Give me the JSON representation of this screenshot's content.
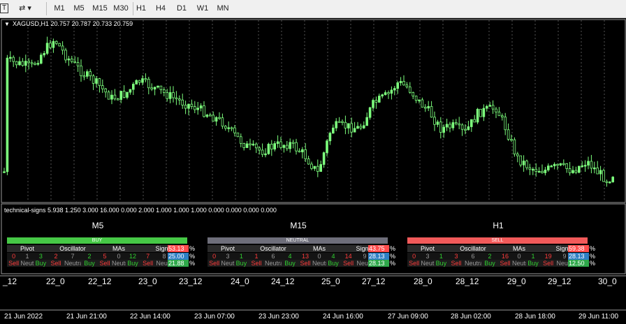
{
  "toolbar": {
    "timeframes": [
      "M1",
      "M5",
      "M15",
      "M30",
      "H1",
      "H4",
      "D1",
      "W1",
      "MN"
    ],
    "active": "H1"
  },
  "chart": {
    "header": "XAGUSD,H1  20.757 20.787 20.733 20.759",
    "subwindow_label": "technical-signs 5.938 1.250 3.000 16.000 0.000 2.000 1.000 1.000 1.000 0.000 0.000 0.000 0.000",
    "custom_time_labels": [
      "_12",
      "22_0",
      "22_12",
      "23_0",
      "23_12",
      "24_0",
      "24_12",
      "25_0",
      "27_12",
      "28_0",
      "28_12",
      "29_0",
      "29_12",
      "30_0"
    ],
    "date_labels": [
      "21 Jun 2022",
      "21 Jun 21:00",
      "22 Jun 14:00",
      "23 Jun 07:00",
      "23 Jun 23:00",
      "24 Jun 16:00",
      "27 Jun 09:00",
      "28 Jun 02:00",
      "28 Jun 18:00",
      "29 Jun 11:00"
    ]
  },
  "signals": [
    {
      "timeframe": "M5",
      "verdict": "BUY",
      "verdict_color": "#46c846",
      "headers": [
        "Pivot",
        "Oscillator",
        "MAs",
        "Signal"
      ],
      "counts": [
        "0",
        "1",
        "3",
        "2",
        "7",
        "2",
        "5",
        "0",
        "12",
        "7",
        "8",
        "17"
      ],
      "legend": "Sell Neutral Buy",
      "percents": [
        "53.13",
        "25.00",
        "21.88"
      ]
    },
    {
      "timeframe": "M15",
      "verdict": "NEUTRAL",
      "verdict_color": "#6e6e7a",
      "headers": [
        "Pivot",
        "Oscillator",
        "MAs",
        "Signal"
      ],
      "counts": [
        "0",
        "3",
        "1",
        "1",
        "6",
        "4",
        "13",
        "0",
        "4",
        "14",
        "9",
        "9"
      ],
      "legend": "Sell Neutral Buy",
      "percents": [
        "43.75",
        "28.13",
        "28.13"
      ]
    },
    {
      "timeframe": "H1",
      "verdict": "SELL",
      "verdict_color": "#f25a5a",
      "headers": [
        "Pivot",
        "Oscillator",
        "MAs",
        "Signal"
      ],
      "counts": [
        "0",
        "3",
        "1",
        "3",
        "6",
        "2",
        "16",
        "0",
        "1",
        "19",
        "9",
        "4"
      ],
      "legend": "Sell Neutral Buy",
      "percents": [
        "59.38",
        "28.13",
        "12.50"
      ]
    }
  ],
  "colors": {
    "bull": "#7dff7d",
    "bear": "#7dff7d",
    "pct_top": "#ff4d4d",
    "pct_mid": "#2e7fc4",
    "pct_bot": "#2ea84a"
  }
}
